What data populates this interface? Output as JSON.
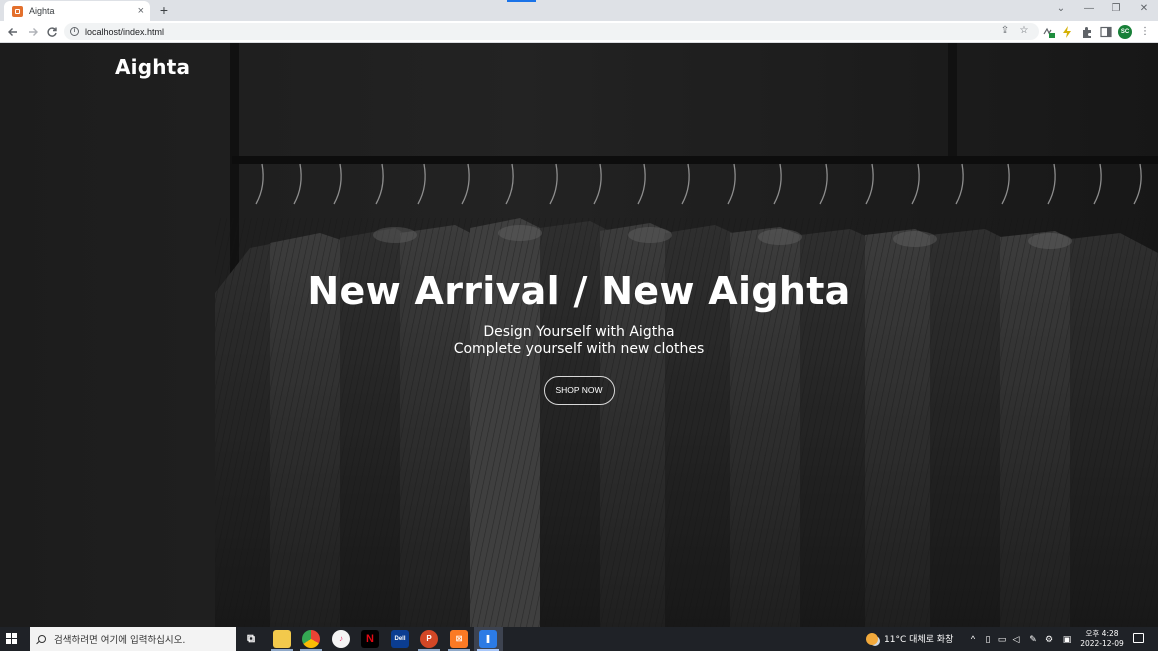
{
  "browser": {
    "tab_title": "Aighta",
    "tab_close": "×",
    "new_tab": "+",
    "url": "localhost/index.html",
    "profile_initials": "SC",
    "controls": {
      "minimize": "—",
      "restore": "❐",
      "close": "✕",
      "tab_search": "⌄"
    }
  },
  "page": {
    "logo": "Aighta",
    "hero": {
      "title": "New Arrival / New Aighta",
      "subtitle_line1": "Design Yourself with Aigtha",
      "subtitle_line2": "Complete yourself with new clothes",
      "cta": "SHOP NOW"
    }
  },
  "taskbar": {
    "search_placeholder": "검색하려면 여기에 입력하십시오.",
    "weather": "11°C 대체로 화창",
    "time": "오후 4:28",
    "date": "2022-12-09",
    "apps": [
      {
        "name": "file-explorer",
        "label": "",
        "color": "#f2c94c"
      },
      {
        "name": "chrome",
        "label": "",
        "color": "#4285f4"
      },
      {
        "name": "itunes",
        "label": "♪",
        "color": "#e84a7c"
      },
      {
        "name": "netflix",
        "label": "N",
        "color": "#000000"
      },
      {
        "name": "dell-app",
        "label": "Dell",
        "color": "#0b3d91"
      },
      {
        "name": "powerpoint",
        "label": "P",
        "color": "#d24726"
      },
      {
        "name": "xampp",
        "label": "⊠",
        "color": "#fb7a24"
      },
      {
        "name": "vscode-like",
        "label": "❚",
        "color": "#2c7be5"
      }
    ]
  },
  "colors": {
    "accent": "#1a73e8",
    "hero_overlay": "#000000",
    "favicon": "#e3702d"
  }
}
